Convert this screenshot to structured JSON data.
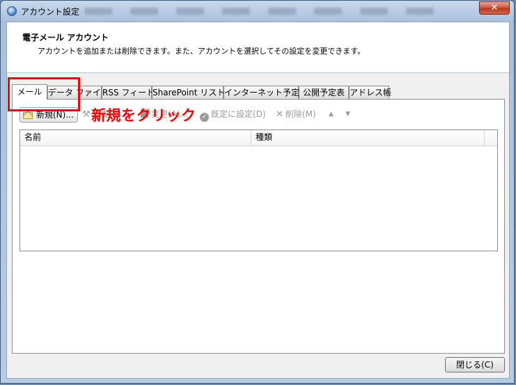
{
  "window": {
    "title": "アカウント設定",
    "close_glyph": "✕"
  },
  "header": {
    "title": "電子メール アカウント",
    "description": "アカウントを追加または削除できます。また、アカウントを選択してその設定を変更できます。"
  },
  "tabs": [
    {
      "label": "メール",
      "active": true
    },
    {
      "label": "データ ファイル"
    },
    {
      "label": "RSS フィード"
    },
    {
      "label": "SharePoint リスト"
    },
    {
      "label": "インターネット予定表"
    },
    {
      "label": "公開予定表"
    },
    {
      "label": "アドレス帳"
    }
  ],
  "toolbar": {
    "new_label": "新規(N)...",
    "repair_label": "修復(R)...",
    "change_label": "変更(A)...",
    "default_label": "既定に設定(D)",
    "delete_label": "削除(M)",
    "up_glyph": "▲",
    "down_glyph": "▼",
    "icons": [
      "envelope-new-icon",
      "repair-icon",
      "change-icon",
      "check-circle-icon",
      "delete-x-icon",
      "up-arrow-icon",
      "down-arrow-icon"
    ]
  },
  "list": {
    "columns": [
      "名前",
      "種類"
    ]
  },
  "annotation": {
    "text": "新規をクリック",
    "color": "#ff0000"
  },
  "footer": {
    "close_label": "閉じる(C)"
  }
}
